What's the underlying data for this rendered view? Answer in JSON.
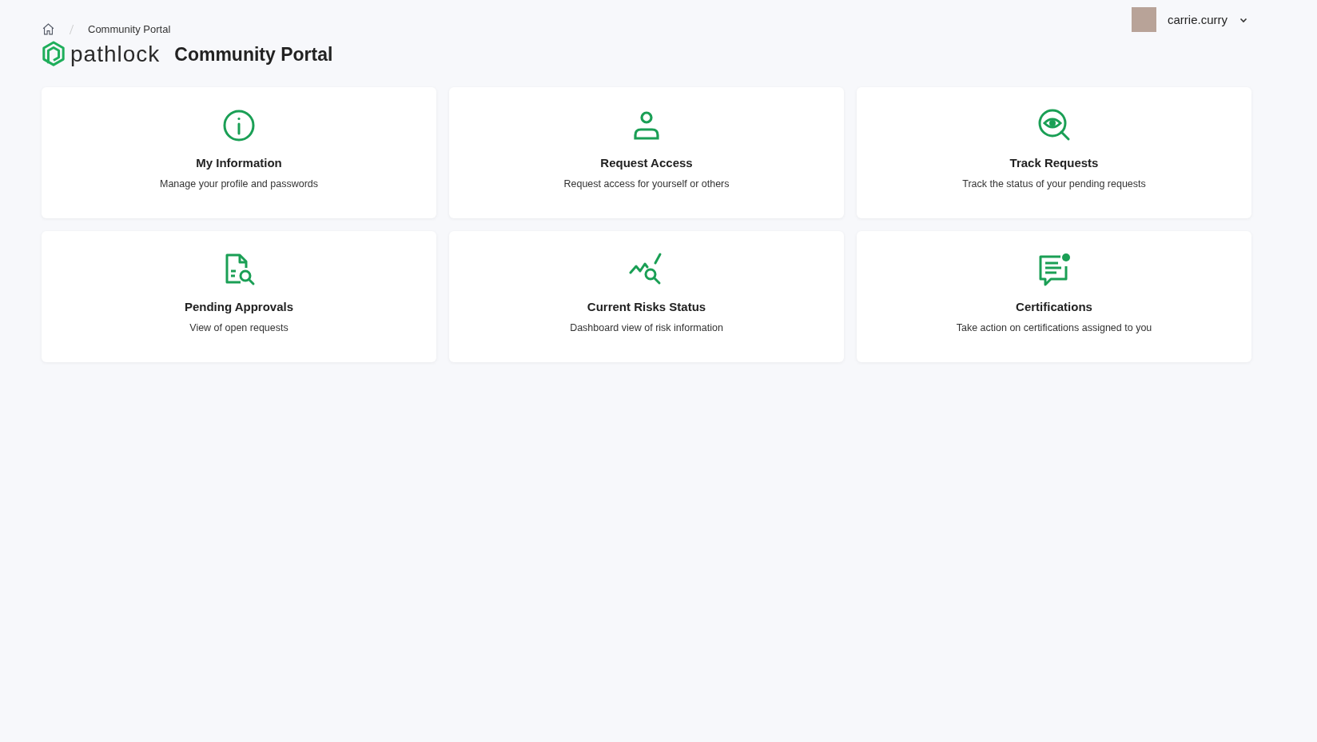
{
  "breadcrumb": {
    "current": "Community Portal"
  },
  "header": {
    "logo_text": "pathlock",
    "title": "Community Portal"
  },
  "user": {
    "name": "carrie.curry"
  },
  "cards": [
    {
      "kind": "info",
      "title": "My Information",
      "description": "Manage your profile and passwords"
    },
    {
      "kind": "person",
      "title": "Request Access",
      "description": "Request access for yourself or others"
    },
    {
      "kind": "eye-search",
      "title": "Track Requests",
      "description": "Track the status of your pending requests"
    },
    {
      "kind": "doc-search",
      "title": "Pending Approvals",
      "description": "View of open requests"
    },
    {
      "kind": "chart-search",
      "title": "Current Risks Status",
      "description": "Dashboard view of risk information"
    },
    {
      "kind": "message",
      "title": "Certifications",
      "description": "Take action on certifications assigned to you"
    }
  ]
}
